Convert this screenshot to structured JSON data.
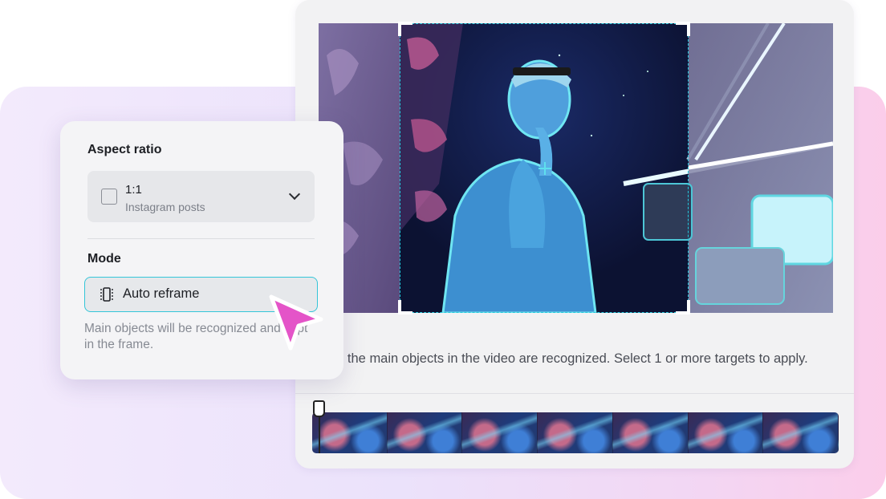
{
  "panel": {
    "aspect_ratio_title": "Aspect ratio",
    "ratio_value": "1:1",
    "ratio_sub": "Instagram posts",
    "mode_title": "Mode",
    "mode_label": "Auto reframe",
    "mode_description": "Main objects will be recognized and kept in the frame."
  },
  "editor": {
    "info_text": "All the main objects in the video are recognized. Select 1 or more targets to apply."
  },
  "timeline": {
    "thumbnail_count": 7
  },
  "colors": {
    "accent": "#34c5d8",
    "cursor": "#e454c8"
  }
}
